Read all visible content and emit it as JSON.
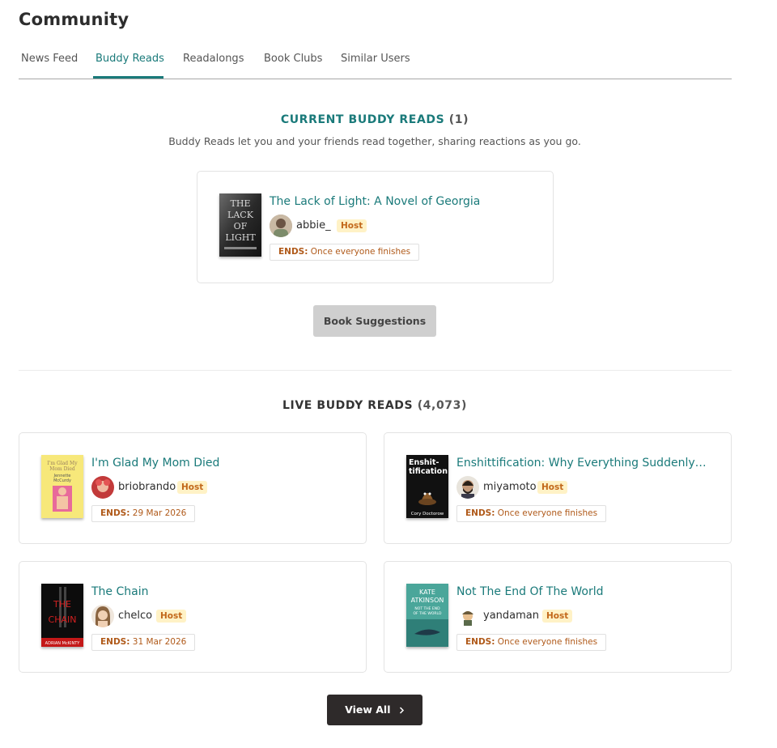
{
  "page": {
    "title": "Community"
  },
  "tabs": [
    "News Feed",
    "Buddy Reads",
    "Readalongs",
    "Book Clubs",
    "Similar Users"
  ],
  "current": {
    "heading": "CURRENT BUDDY READS",
    "count": "(1)",
    "subtitle": "Buddy Reads let you and your friends read together, sharing reactions as you go.",
    "book": {
      "title": "The Lack of Light: A Novel of Georgia",
      "host": "abbie_",
      "badge": "Host",
      "ends_label": "ENDS:",
      "ends_value": "Once everyone finishes",
      "cover_text": "THE LACK OF LIGHT"
    },
    "suggest_label": "Book Suggestions"
  },
  "live": {
    "heading": "LIVE BUDDY READS",
    "count": "(4,073)",
    "items": [
      {
        "title": "I'm Glad My Mom Died",
        "host": "briobrando",
        "badge": "Host",
        "ends_label": "ENDS:",
        "ends_value": "29 Mar 2026",
        "cover_text": "I'm Glad My Mom Died"
      },
      {
        "title": "Enshittification: Why Everything Suddenly…",
        "host": "miyamoto",
        "badge": "Host",
        "ends_label": "ENDS:",
        "ends_value": "Once everyone finishes",
        "cover_text": "Enshit-tification",
        "cover_author": "Cory Doctorow"
      },
      {
        "title": "The Chain",
        "host": "chelco",
        "badge": "Host",
        "ends_label": "ENDS:",
        "ends_value": "31 Mar 2026",
        "cover_text": "THE CHAIN"
      },
      {
        "title": "Not The End Of The World",
        "host": "yandaman",
        "badge": "Host",
        "ends_label": "ENDS:",
        "ends_value": "Once everyone finishes",
        "cover_text": "KATE ATKINSON"
      }
    ],
    "view_all_label": "View All",
    "view_all_icon": "chevron-right-icon"
  },
  "colors": {
    "accent": "#1a7a7a",
    "badge_bg": "#fff2c6",
    "badge_text": "#c2681a",
    "ends_text": "#b05a1a"
  }
}
